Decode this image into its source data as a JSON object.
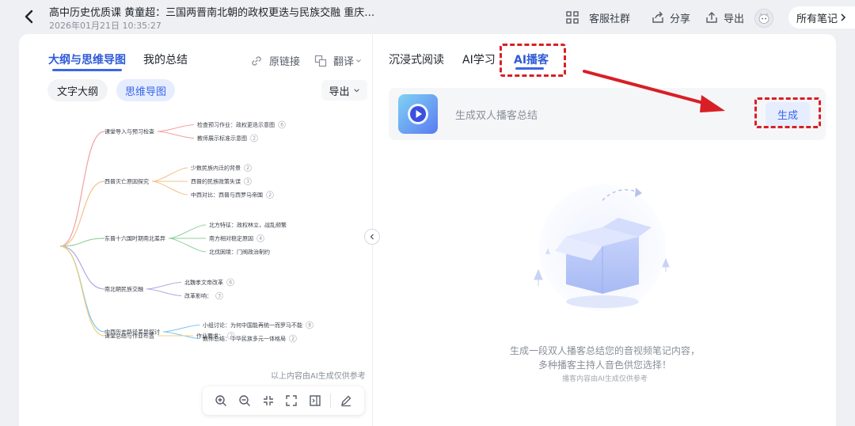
{
  "header": {
    "title": "高中历史优质课 黄童超：三国两晋南北朝的政权更迭与民族交融 重庆…",
    "timestamp": "2026年01月21日 10:35:27",
    "customer_group": "客服社群",
    "share": "分享",
    "export": "导出",
    "all_notes": "所有笔记"
  },
  "left": {
    "tab_outline_map": "大纲与思维导图",
    "tab_summary": "我的总结",
    "original_link": "原链接",
    "translate": "翻译",
    "pill_text_outline": "文字大纲",
    "pill_mindmap": "思维导图",
    "export": "导出",
    "disclaimer": "以上内容由AI生成仅供参考"
  },
  "mindmap": {
    "branches": [
      {
        "label": "课堂导入与预习检查",
        "children": [
          {
            "label": "检查预习作业：政权更迭示意图",
            "num": "6"
          },
          {
            "label": "教师展示标准示意图",
            "num": "2"
          }
        ]
      },
      {
        "label": "西晋灭亡原因探究",
        "children": [
          {
            "label": "少数民族内迁的背景",
            "num": "2"
          },
          {
            "label": "西晋的民族政策失误",
            "num": "3"
          },
          {
            "label": "中西对比：西晋与西罗马帝国",
            "num": "2"
          }
        ]
      },
      {
        "label": "东晋十六国时期南北差异",
        "children": [
          {
            "label": "北方特征：政权林立，战乱频繁",
            "num": ""
          },
          {
            "label": "南方相对稳定原因",
            "num": "4"
          },
          {
            "label": "北伐困境：门阀政治制约",
            "num": ""
          }
        ]
      },
      {
        "label": "南北朝民族交融",
        "children": [
          {
            "label": "北魏孝文帝改革",
            "num": "6"
          },
          {
            "label": "改革影响：",
            "num": "3"
          }
        ]
      },
      {
        "label": "中西历史路径差异探讨",
        "children": [
          {
            "label": "小组讨论：为何中国能再统一而罗马不能",
            "num": "8"
          },
          {
            "label": "教师总结：中华民族多元一体格局",
            "num": "2"
          }
        ]
      },
      {
        "label": "课堂总结与作业布置",
        "children": [
          {
            "label": "作业要求：",
            "num": "2"
          }
        ]
      }
    ],
    "colors": [
      "#f3a0a0",
      "#f4c08a",
      "#8fd19e",
      "#b7a6e8",
      "#7cc4f0",
      "#f0d27c"
    ]
  },
  "right": {
    "tab_immersive": "沉浸式阅读",
    "tab_ai_study": "AI学习",
    "tab_ai_podcast": "AI播客",
    "card_text": "生成双人播客总结",
    "generate": "生成",
    "empty_line1": "生成一段双人播客总结您的音视频笔记内容，",
    "empty_line2": "多种播客主持人音色供您选择！",
    "empty_note": "播客内容由AI生成仅供参考"
  },
  "colors": {
    "accent": "#3a66e8",
    "annotation_red": "#d81f26"
  }
}
